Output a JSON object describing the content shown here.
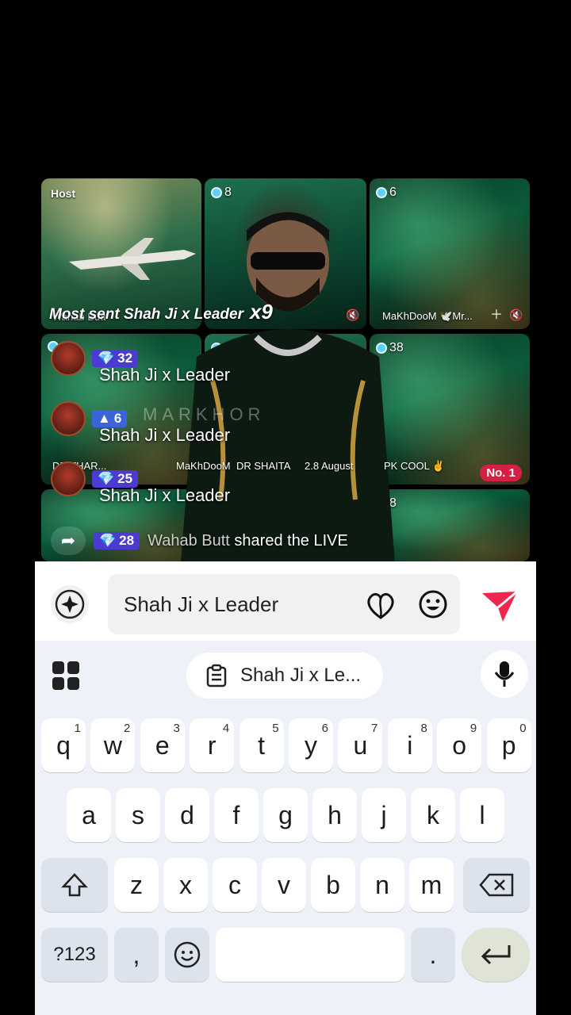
{
  "live": {
    "host_label": "Host",
    "tiles": [
      {
        "count": "8",
        "name": ""
      },
      {
        "count": "6",
        "name": "MaKhDooM"
      },
      {
        "count": "8",
        "name": ""
      },
      {
        "count": "38",
        "name": ""
      },
      {
        "count": "8",
        "name": ""
      }
    ],
    "top_row_names": {
      "left": "Wahab Butt",
      "tile3": "MaKhDooM 🕊️Mr..."
    },
    "bottom_row_names": {
      "a": "DR THAR...",
      "b": "MaKhDooM",
      "c": "DR SHAITA",
      "d": "2.8 August",
      "e": "PK COOL ✌️"
    },
    "rank_badge": "No. 1",
    "most_sent": {
      "label": "Most sent Shah Ji x Leader",
      "multiplier": "x9"
    },
    "comments": [
      {
        "gem": "32",
        "text": "Shah Ji x Leader"
      },
      {
        "gem": "6",
        "text": "Shah Ji x Leader"
      },
      {
        "gem": "25",
        "text": "Shah Ji x Leader"
      }
    ],
    "watermark": "MARKHOR",
    "shared": {
      "gem": "28",
      "who": "Wahab Butt",
      "text": "shared the LIVE"
    }
  },
  "composer": {
    "value": "Shah Ji x Leader"
  },
  "keyboard": {
    "clipboard_suggestion": "Shah Ji x Le...",
    "row1": [
      {
        "k": "q",
        "s": "1"
      },
      {
        "k": "w",
        "s": "2"
      },
      {
        "k": "e",
        "s": "3"
      },
      {
        "k": "r",
        "s": "4"
      },
      {
        "k": "t",
        "s": "5"
      },
      {
        "k": "y",
        "s": "6"
      },
      {
        "k": "u",
        "s": "7"
      },
      {
        "k": "i",
        "s": "8"
      },
      {
        "k": "o",
        "s": "9"
      },
      {
        "k": "p",
        "s": "0"
      }
    ],
    "row2": [
      "a",
      "s",
      "d",
      "f",
      "g",
      "h",
      "j",
      "k",
      "l"
    ],
    "row3": [
      "z",
      "x",
      "c",
      "v",
      "b",
      "n",
      "m"
    ],
    "symbols_key": "?123",
    "comma_key": ",",
    "period_key": "."
  },
  "colors": {
    "send": "#f0264f",
    "gem": "#4c3bd0",
    "rank": "#d51f45"
  },
  "icons": [
    "spark-icon",
    "heart-icon",
    "emoji-icon",
    "send-icon",
    "apps-icon",
    "clipboard-icon",
    "mic-icon",
    "shift-icon",
    "backspace-icon",
    "emoji-key-icon",
    "enter-icon",
    "share-icon",
    "mic-off-icon",
    "plus-icon"
  ]
}
